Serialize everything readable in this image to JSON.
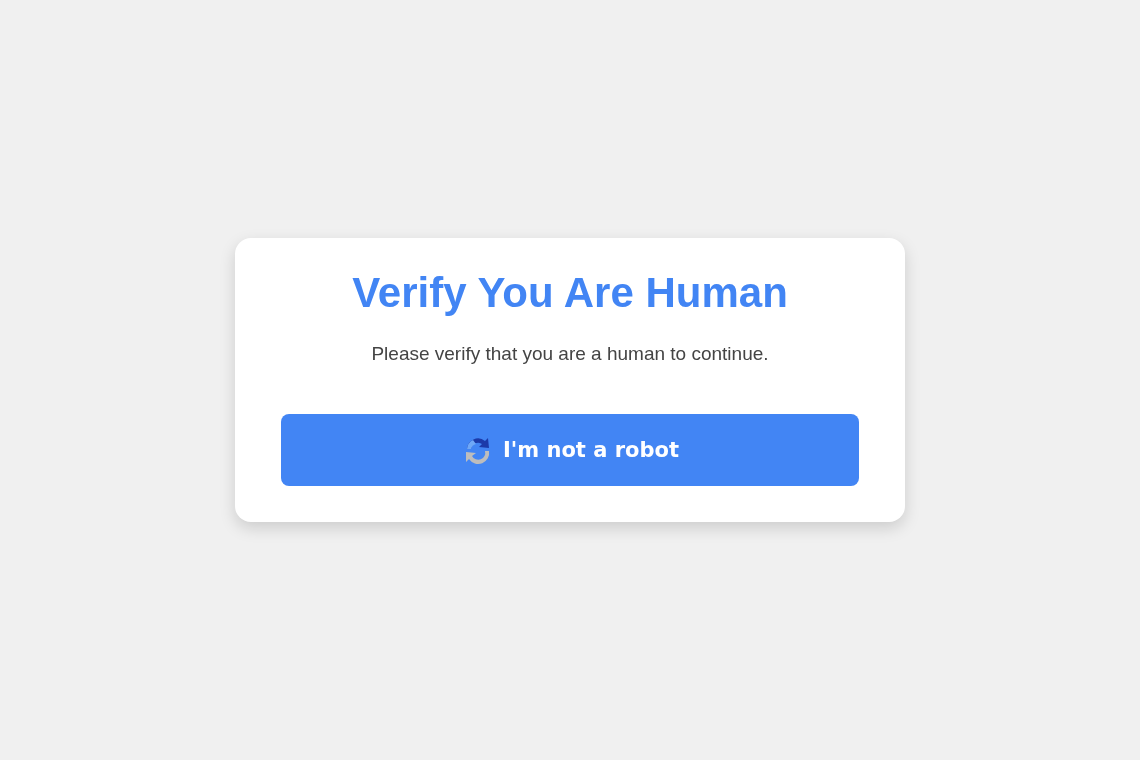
{
  "card": {
    "title": "Verify You Are Human",
    "message": "Please verify that you are a human to continue.",
    "button": {
      "label": "I'm not a robot"
    }
  }
}
